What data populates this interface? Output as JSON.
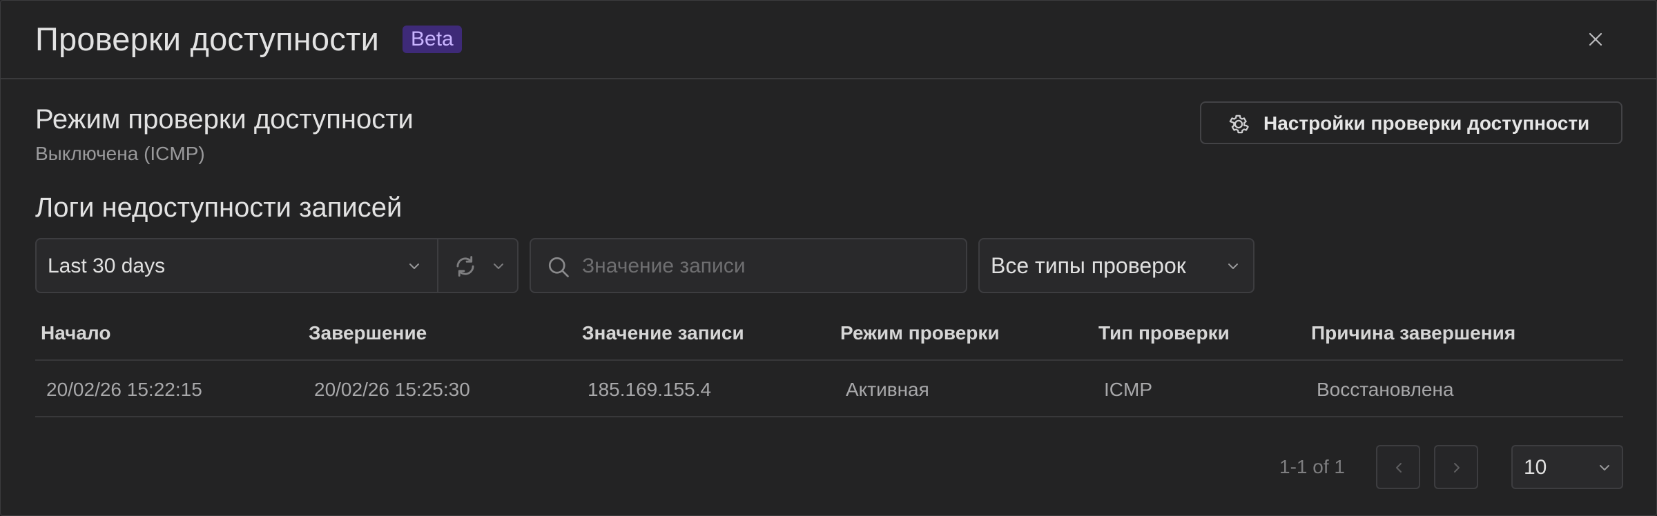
{
  "modal": {
    "title": "Проверки доступности",
    "badge": "Beta"
  },
  "mode_section": {
    "title": "Режим проверки доступности",
    "status": "Выключена (ICMP)",
    "settings_button": "Настройки проверки доступности"
  },
  "logs_section": {
    "title": "Логи недоступности записей"
  },
  "filters": {
    "date_range": "Last 30 days",
    "search_placeholder": "Значение записи",
    "check_type": "Все типы проверок"
  },
  "table": {
    "columns": [
      "Начало",
      "Завершение",
      "Значение записи",
      "Режим проверки",
      "Тип проверки",
      "Причина завершения"
    ],
    "rows": [
      [
        "20/02/26 15:22:15",
        "20/02/26 15:25:30",
        "185.169.155.4",
        "Активная",
        "ICMP",
        "Восстановлена"
      ]
    ]
  },
  "pagination": {
    "info": "1-1 of 1",
    "page_size": "10"
  },
  "icons": [
    "close-icon",
    "gear-icon",
    "chevron-down-icon",
    "refresh-icon",
    "search-icon",
    "chevron-left-icon",
    "chevron-right-icon"
  ],
  "colors": {
    "background": "#232324",
    "badge_bg": "#3e2a78",
    "badge_text": "#c9b4ff",
    "border": "#3d3d40"
  }
}
